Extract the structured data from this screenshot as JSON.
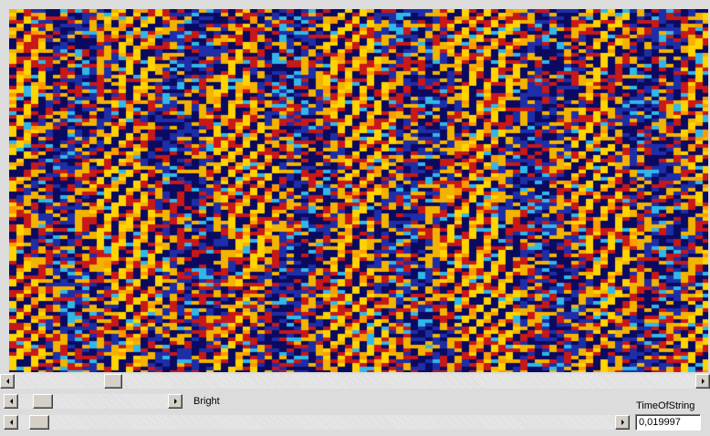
{
  "display": {
    "palette": [
      "#1e2ea8",
      "#0a0a60",
      "#c81818",
      "#f2b400",
      "#ffd400",
      "#30b8e8",
      "#ff9a00"
    ]
  },
  "controls": {
    "bright_label": "Bright",
    "time_label": "TimeOfString",
    "time_value": "0,019997"
  },
  "icons": {
    "scroll_left": "arrow-left-icon",
    "scroll_right": "arrow-right-icon"
  }
}
